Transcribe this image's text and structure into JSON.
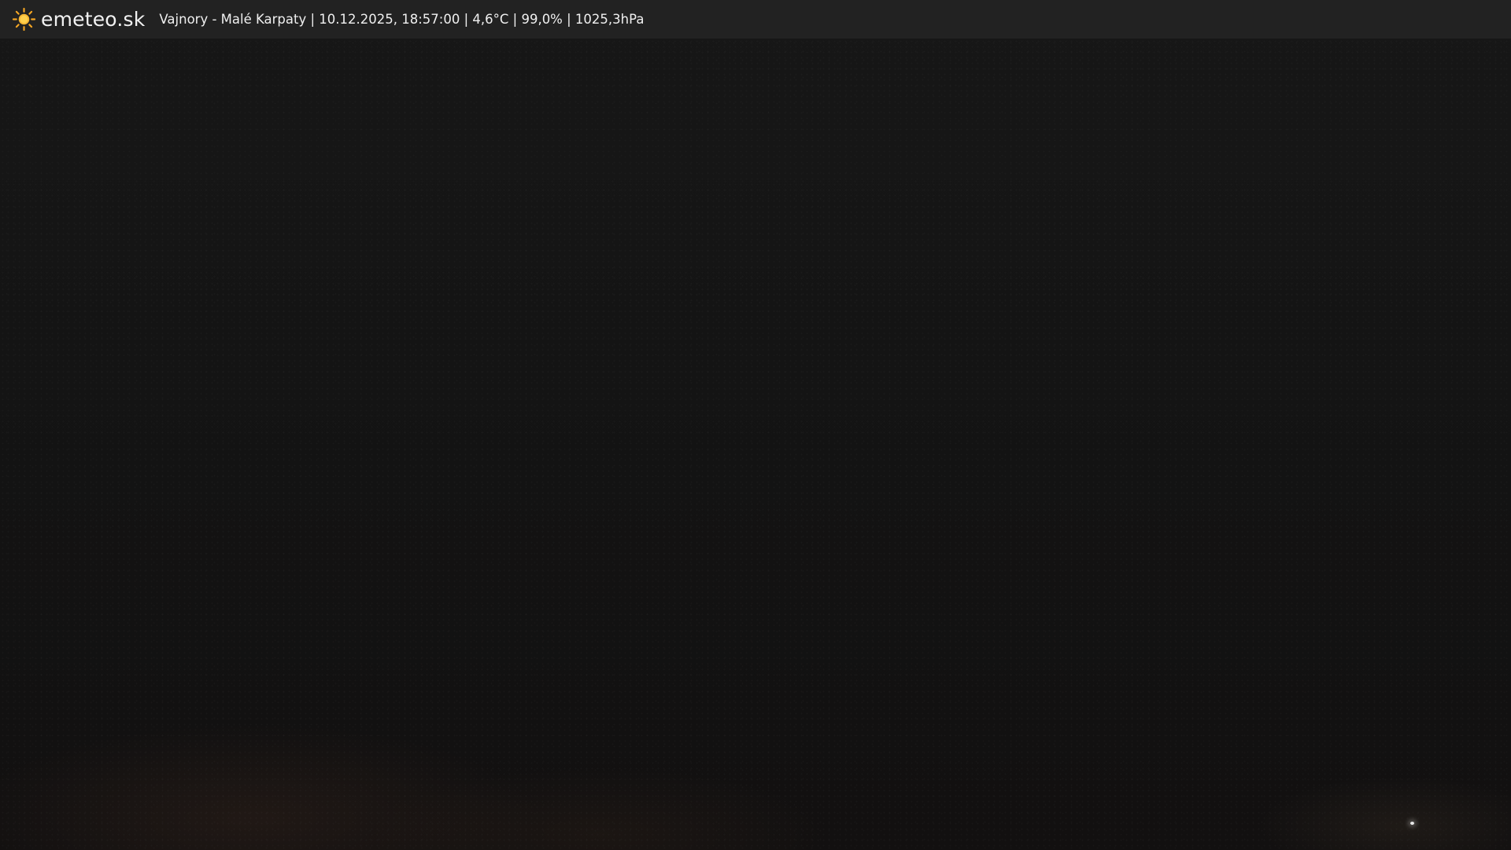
{
  "header": {
    "brand": "emeteo.sk",
    "station_info": "Vajnory - Malé Karpaty | 10.12.2025, 18:57:00 | 4,6°C | 99,0% | 1025,3hPa",
    "logo_icon": "sun-icon",
    "accent_color": "#f5a623"
  },
  "webcam": {
    "scene": "night-sky-dark"
  }
}
